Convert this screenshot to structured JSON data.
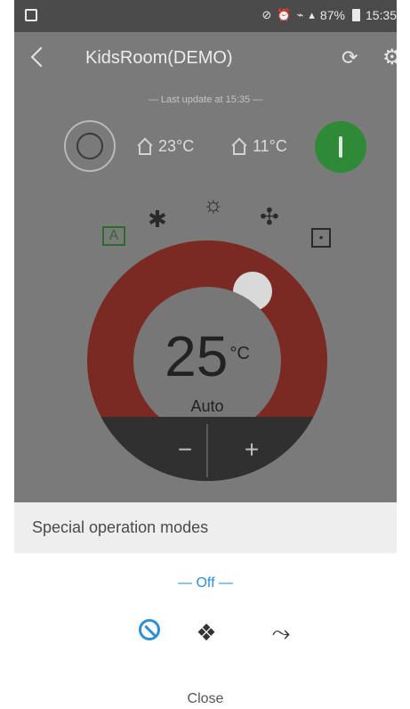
{
  "status_bar": {
    "battery": "87%",
    "time": "15:35",
    "icons": [
      "image-icon",
      "mute-icon",
      "alarm-icon",
      "wifi-icon",
      "signal-icon",
      "battery-icon"
    ]
  },
  "appbar": {
    "title": "KidsRoom(DEMO)",
    "icons": [
      "back-icon",
      "refresh-icon",
      "gear-icon"
    ]
  },
  "update_text": "— Last update at 15:35 —",
  "temps": {
    "indoor": "23°C",
    "outdoor": "11°C"
  },
  "modes": {
    "auto_label": "A",
    "icons": [
      "auto-mode-icon",
      "cool-mode-icon",
      "heat-mode-icon",
      "fan-mode-icon",
      "dry-mode-icon"
    ]
  },
  "dial": {
    "temperature": "25",
    "unit": "°C",
    "mode": "Auto",
    "minus": "−",
    "plus": "+"
  },
  "sheet": {
    "title": "Special operation modes",
    "state": "— Off —",
    "options": [
      "off-icon",
      "eco-icon",
      "powerful-icon"
    ],
    "close": "Close"
  },
  "colors": {
    "accent": "#2f8fd0",
    "power_on": "#2e8a36",
    "dial_ring": "#7a2a22"
  }
}
